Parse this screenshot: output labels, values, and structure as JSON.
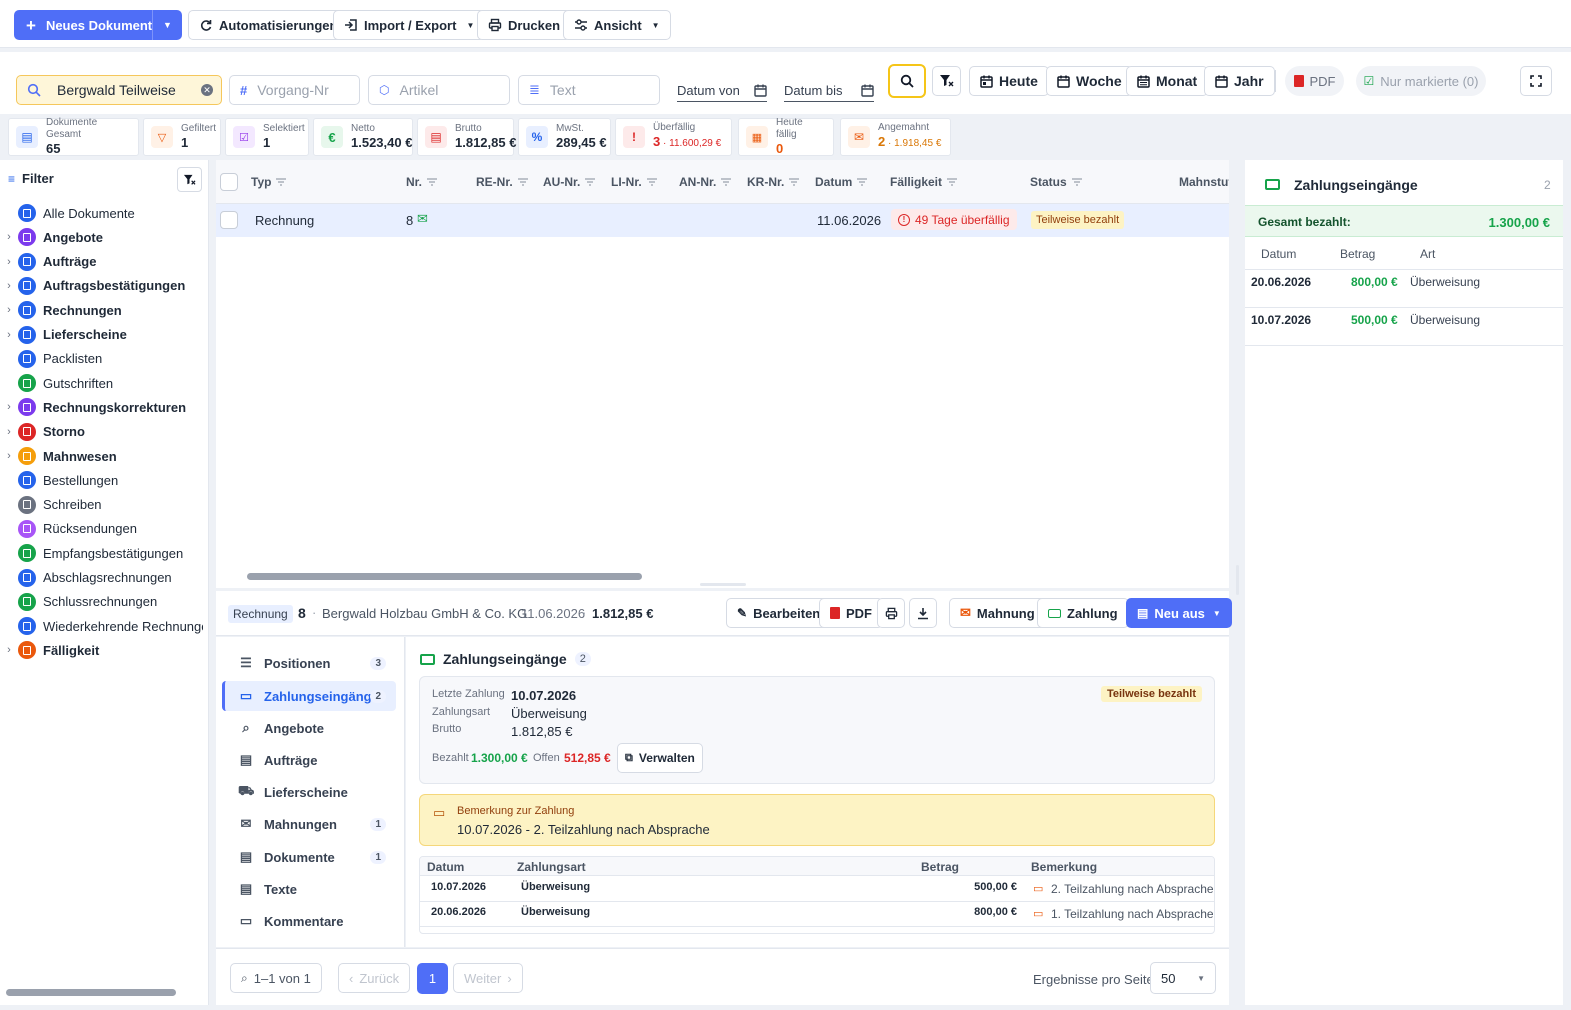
{
  "toolbar": {
    "new_doc": "Neues Dokument",
    "automations": "Automatisierungen",
    "import_export": "Import / Export",
    "print": "Drucken",
    "view": "Ansicht"
  },
  "search": {
    "query": "Bergwald Teilweise",
    "vorgang_placeholder": "Vorgang-Nr",
    "artikel_placeholder": "Artikel",
    "text_placeholder": "Text",
    "date_from": "Datum von",
    "date_to": "Datum bis",
    "today": "Heute",
    "week": "Woche",
    "month": "Monat",
    "year": "Jahr",
    "pdf": "PDF",
    "only_marked": "Nur markierte (0)"
  },
  "stats": [
    {
      "label": "Dokumente Gesamt",
      "value": "65"
    },
    {
      "label": "Gefiltert",
      "value": "1"
    },
    {
      "label": "Selektiert",
      "value": "1"
    },
    {
      "label": "Netto",
      "value": "1.523,40 €"
    },
    {
      "label": "Brutto",
      "value": "1.812,85 €"
    },
    {
      "label": "MwSt.",
      "value": "289,45 €"
    },
    {
      "label": "Überfällig",
      "value": "3",
      "sub": "11.600,29 €"
    },
    {
      "label": "Heute fällig",
      "value": "0"
    },
    {
      "label": "Angemahnt",
      "value": "2",
      "sub": "1.918,45 €"
    }
  ],
  "sidebar": {
    "title": "Filter",
    "items": [
      {
        "label": "Alle Dokumente",
        "bold": false,
        "chev": false,
        "color": "#2563eb"
      },
      {
        "label": "Angebote",
        "bold": true,
        "chev": true,
        "color": "#7c3aed"
      },
      {
        "label": "Aufträge",
        "bold": true,
        "chev": true,
        "color": "#2563eb"
      },
      {
        "label": "Auftragsbestätigungen",
        "bold": true,
        "chev": true,
        "color": "#2563eb"
      },
      {
        "label": "Rechnungen",
        "bold": true,
        "chev": true,
        "color": "#2563eb"
      },
      {
        "label": "Lieferscheine",
        "bold": true,
        "chev": true,
        "color": "#2563eb"
      },
      {
        "label": "Packlisten",
        "bold": false,
        "chev": false,
        "color": "#2563eb"
      },
      {
        "label": "Gutschriften",
        "bold": false,
        "chev": false,
        "color": "#16a34a"
      },
      {
        "label": "Rechnungskorrekturen",
        "bold": true,
        "chev": true,
        "color": "#7c3aed"
      },
      {
        "label": "Storno",
        "bold": true,
        "chev": true,
        "color": "#dc2626"
      },
      {
        "label": "Mahnwesen",
        "bold": true,
        "chev": true,
        "color": "#f59e0b"
      },
      {
        "label": "Bestellungen",
        "bold": false,
        "chev": false,
        "color": "#2563eb"
      },
      {
        "label": "Schreiben",
        "bold": false,
        "chev": false,
        "color": "#6b7280"
      },
      {
        "label": "Rücksendungen",
        "bold": false,
        "chev": false,
        "color": "#a855f7"
      },
      {
        "label": "Empfangsbestätigungen",
        "bold": false,
        "chev": false,
        "color": "#16a34a"
      },
      {
        "label": "Abschlagsrechnungen",
        "bold": false,
        "chev": false,
        "color": "#2563eb"
      },
      {
        "label": "Schlussrechnungen",
        "bold": false,
        "chev": false,
        "color": "#16a34a"
      },
      {
        "label": "Wiederkehrende Rechnungen",
        "bold": false,
        "chev": false,
        "color": "#2563eb"
      },
      {
        "label": "Fälligkeit",
        "bold": true,
        "chev": true,
        "color": "#ea580c"
      }
    ]
  },
  "table": {
    "columns": [
      "Typ",
      "Nr.",
      "RE-Nr.",
      "AU-Nr.",
      "LI-Nr.",
      "AN-Nr.",
      "KR-Nr.",
      "Datum",
      "Fälligkeit",
      "Status",
      "Mahnstufe"
    ],
    "row": {
      "typ": "Rechnung",
      "nr": "8",
      "datum": "11.06.2026",
      "faelligkeit": "49 Tage überfällig",
      "status": "Teilweise bezahlt"
    }
  },
  "detail": {
    "type_badge": "Rechnung",
    "nr": "8",
    "customer": "Bergwald Holzbau GmbH & Co. KG",
    "date": "11.06.2026",
    "amount": "1.812,85 €",
    "actions": {
      "edit": "Bearbeiten",
      "pdf": "PDF",
      "dunning": "Mahnung",
      "payment": "Zahlung",
      "new_from": "Neu aus"
    },
    "tabs": [
      {
        "label": "Positionen",
        "count": "3"
      },
      {
        "label": "Zahlungseingänge",
        "count": "2"
      },
      {
        "label": "Angebote",
        "count": ""
      },
      {
        "label": "Aufträge",
        "count": ""
      },
      {
        "label": "Lieferscheine",
        "count": ""
      },
      {
        "label": "Mahnungen",
        "count": "1"
      },
      {
        "label": "Dokumente",
        "count": "1"
      },
      {
        "label": "Texte",
        "count": ""
      },
      {
        "label": "Kommentare",
        "count": ""
      }
    ],
    "payments": {
      "title": "Zahlungseingänge",
      "count": "2",
      "last_payment_label": "Letzte Zahlung",
      "last_payment": "10.07.2026",
      "method_label": "Zahlungsart",
      "method": "Überweisung",
      "gross_label": "Brutto",
      "gross": "1.812,85 €",
      "status": "Teilweise bezahlt",
      "paid_label": "Bezahlt",
      "paid": "1.300,00 €",
      "open_label": "Offen",
      "open": "512,85 €",
      "manage": "Verwalten",
      "note_title": "Bemerkung zur Zahlung",
      "note_text": "10.07.2026 - 2. Teilzahlung nach Absprache",
      "cols": [
        "Datum",
        "Zahlungsart",
        "Betrag",
        "Bemerkung"
      ],
      "rows": [
        {
          "date": "10.07.2026",
          "method": "Überweisung",
          "amount": "500,00 €",
          "note": "2. Teilzahlung nach Absprache"
        },
        {
          "date": "20.06.2026",
          "method": "Überweisung",
          "amount": "800,00 €",
          "note": "1. Teilzahlung nach Absprache"
        }
      ]
    }
  },
  "pagination": {
    "range": "1–1 von 1",
    "prev": "Zurück",
    "page": "1",
    "next": "Weiter",
    "per_page_label": "Ergebnisse pro Seite",
    "per_page": "50"
  },
  "right_panel": {
    "title": "Zahlungseingänge",
    "count": "2",
    "total_label": "Gesamt bezahlt:",
    "total": "1.300,00 €",
    "cols": [
      "Datum",
      "Betrag",
      "Art"
    ],
    "rows": [
      {
        "date": "20.06.2026",
        "amount": "800,00 €",
        "type": "Überweisung"
      },
      {
        "date": "10.07.2026",
        "amount": "500,00 €",
        "type": "Überweisung"
      }
    ]
  }
}
